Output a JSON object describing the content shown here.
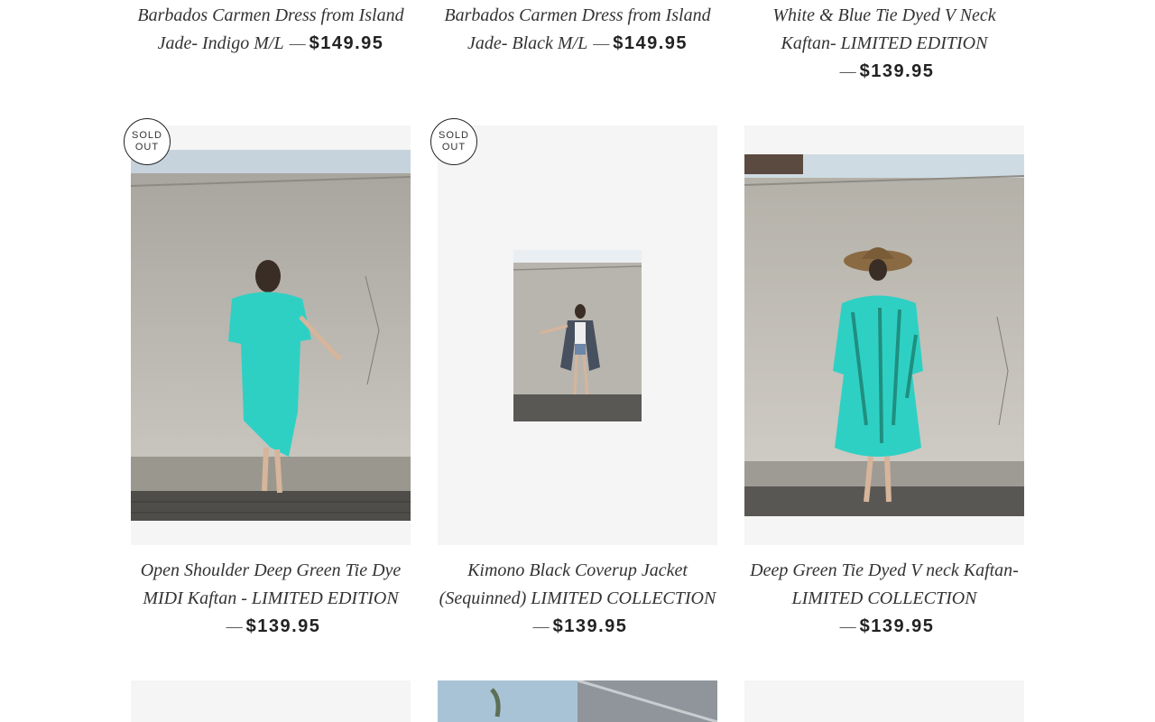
{
  "top_row": [
    {
      "title_line1": "Barbados Carmen Dress from Island",
      "title_line2": "Jade- Indigo M/L",
      "dash": "—",
      "price": "$149.95"
    },
    {
      "title_line1": "Barbados Carmen Dress from Island",
      "title_line2": "Jade- Black M/L",
      "dash": "—",
      "price": "$149.95"
    },
    {
      "title_line1": "White & Blue Tie Dyed V Neck",
      "title_line2": "Kaftan- LIMITED EDITION",
      "dash": "—",
      "price": "$139.95"
    }
  ],
  "middle_row": [
    {
      "badge_line1": "SOLD",
      "badge_line2": "OUT",
      "title_line1": "Open Shoulder Deep Green Tie Dye",
      "title_line2": "MIDI Kaftan - LIMITED EDITION",
      "dash": "—",
      "price": "$139.95"
    },
    {
      "badge_line1": "SOLD",
      "badge_line2": "OUT",
      "title_line1": "Kimono Black Coverup Jacket",
      "title_line2": "(Sequinned) LIMITED COLLECTION",
      "dash": "—",
      "price": "$139.95"
    },
    {
      "title_line1": "Deep Green Tie Dyed V neck Kaftan-",
      "title_line2": "LIMITED COLLECTION",
      "dash": "—",
      "price": "$139.95"
    }
  ],
  "colors": {
    "card_bg": "#f5f5f5",
    "wall": "#b9b6ae",
    "turquoise": "#2fd0c4",
    "deep_green": "#1f8f80"
  }
}
